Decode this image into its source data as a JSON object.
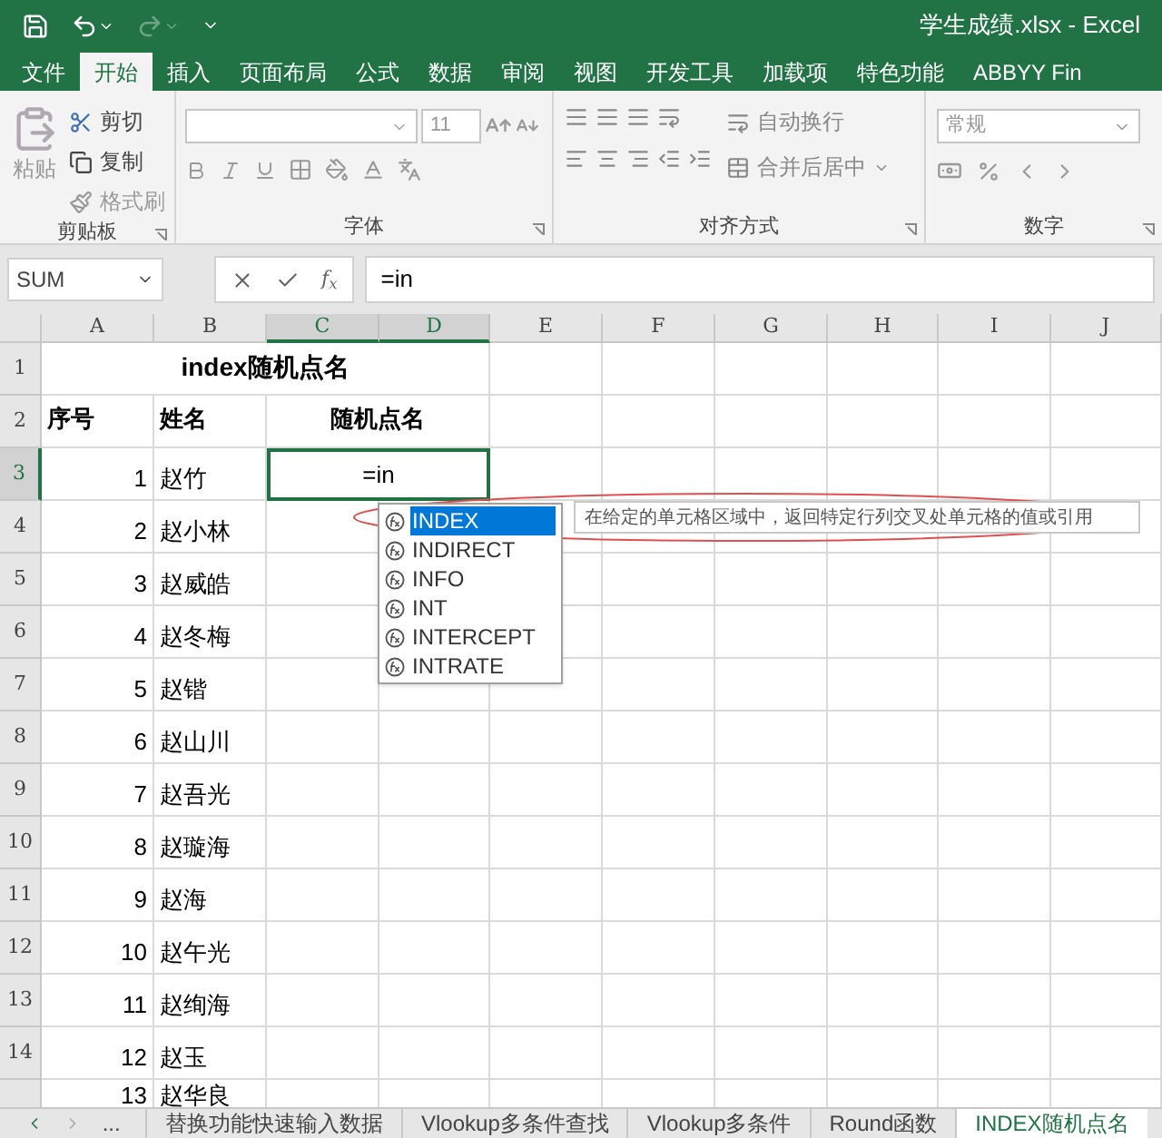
{
  "window": {
    "title": "学生成绩.xlsx - Excel"
  },
  "ribbon_tabs": [
    {
      "label": "文件",
      "selected": false
    },
    {
      "label": "开始",
      "selected": true
    },
    {
      "label": "插入",
      "selected": false
    },
    {
      "label": "页面布局",
      "selected": false
    },
    {
      "label": "公式",
      "selected": false
    },
    {
      "label": "数据",
      "selected": false
    },
    {
      "label": "审阅",
      "selected": false
    },
    {
      "label": "视图",
      "selected": false
    },
    {
      "label": "开发工具",
      "selected": false
    },
    {
      "label": "加载项",
      "selected": false
    },
    {
      "label": "特色功能",
      "selected": false
    },
    {
      "label": "ABBYY Fin",
      "selected": false
    }
  ],
  "ribbon": {
    "clipboard": {
      "paste": "粘贴",
      "cut": "剪切",
      "copy": "复制",
      "format_painter": "格式刷",
      "label": "剪贴板"
    },
    "font": {
      "size": "11",
      "label": "字体"
    },
    "alignment": {
      "wrap": "自动换行",
      "merge": "合并后居中",
      "label": "对齐方式"
    },
    "number": {
      "format": "常规",
      "label": "数字"
    }
  },
  "formula_bar": {
    "name_box": "SUM",
    "fx": "f$_{x}$",
    "formula": "=in"
  },
  "columns": [
    {
      "label": "A",
      "selected": false
    },
    {
      "label": "B",
      "selected": false
    },
    {
      "label": "C",
      "selected": true
    },
    {
      "label": "D",
      "selected": true
    },
    {
      "label": "E",
      "selected": false
    },
    {
      "label": "F",
      "selected": false
    },
    {
      "label": "G",
      "selected": false
    },
    {
      "label": "H",
      "selected": false
    },
    {
      "label": "I",
      "selected": false
    },
    {
      "label": "J",
      "selected": false
    }
  ],
  "sheet": {
    "title_row": {
      "row": "1",
      "title": "index随机点名"
    },
    "header_row": {
      "row": "2",
      "headers": [
        "序号",
        "姓名",
        "随机点名"
      ]
    },
    "active_cell": {
      "value": "=in"
    },
    "rows": [
      {
        "row": "3",
        "number": "1",
        "name": "赵竹",
        "selected": true
      },
      {
        "row": "4",
        "number": "2",
        "name": "赵小林",
        "selected": false
      },
      {
        "row": "5",
        "number": "3",
        "name": "赵威皓",
        "selected": false
      },
      {
        "row": "6",
        "number": "4",
        "name": "赵冬梅",
        "selected": false
      },
      {
        "row": "7",
        "number": "5",
        "name": "赵锴",
        "selected": false
      },
      {
        "row": "8",
        "number": "6",
        "name": "赵山川",
        "selected": false
      },
      {
        "row": "9",
        "number": "7",
        "name": "赵吾光",
        "selected": false
      },
      {
        "row": "10",
        "number": "8",
        "name": "赵璇海",
        "selected": false
      },
      {
        "row": "11",
        "number": "9",
        "name": "赵海",
        "selected": false
      },
      {
        "row": "12",
        "number": "10",
        "name": "赵午光",
        "selected": false
      },
      {
        "row": "13",
        "number": "11",
        "name": "赵绚海",
        "selected": false
      },
      {
        "row": "14",
        "number": "12",
        "name": "赵玉",
        "selected": false
      },
      {
        "number": "13",
        "name": "赵华良",
        "selected": false
      }
    ]
  },
  "autocomplete": {
    "items": [
      {
        "label": "INDEX",
        "selected": true
      },
      {
        "label": "INDIRECT",
        "selected": false
      },
      {
        "label": "INFO",
        "selected": false
      },
      {
        "label": "INT",
        "selected": false
      },
      {
        "label": "INTERCEPT",
        "selected": false
      },
      {
        "label": "INTRATE",
        "selected": false
      }
    ],
    "tooltip": "在给定的单元格区域中，返回特定行列交叉处单元格的值或引用"
  },
  "sheet_tabs": {
    "more": "...",
    "tabs": [
      {
        "label": "替换功能快速输入数据",
        "selected": false
      },
      {
        "label": "Vlookup多条件查找",
        "selected": false
      },
      {
        "label": "Vlookup多条件",
        "selected": false
      },
      {
        "label": "Round函数",
        "selected": false
      },
      {
        "label": "INDEX随机点名",
        "selected": true
      }
    ]
  }
}
